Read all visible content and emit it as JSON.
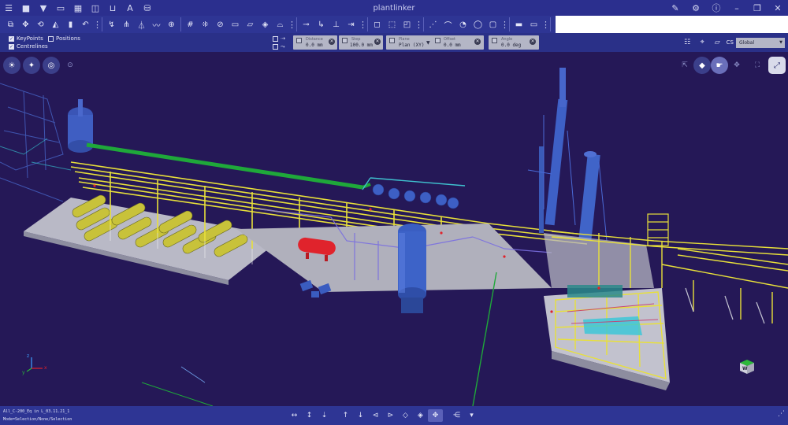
{
  "app": {
    "title": "plantlinker"
  },
  "titlebar": {
    "left_icons": [
      "menu-icon",
      "save-icon",
      "filter-icon",
      "folder-icon",
      "grid-icon",
      "layers-icon",
      "bucket-icon",
      "text-icon",
      "database-icon"
    ],
    "right_icons": [
      "edit-icon",
      "settings-icon",
      "info-icon",
      "minimize-icon",
      "restore-icon",
      "close-icon"
    ]
  },
  "toolbar": {
    "groups": [
      [
        "copy-icon",
        "move-icon",
        "rotate-icon",
        "mirror-icon",
        "delete-icon",
        "undo-icon"
      ],
      [
        "route-icon",
        "branch-icon",
        "tree-icon",
        "line-icon",
        "target-icon"
      ],
      [
        "grid-snap-icon",
        "node-icon",
        "slash-icon",
        "rect-icon",
        "surface-icon",
        "cube-icon",
        "arc-icon"
      ],
      [
        "pipe-icon",
        "bend-icon",
        "tee-icon",
        "connect-icon"
      ],
      [
        "box-icon",
        "box-open-icon",
        "box-layer-icon"
      ],
      [
        "dotline-icon",
        "curve-icon",
        "circle-arrow-icon",
        "circle-icon",
        "shape-icon"
      ],
      [
        "rail-icon",
        "rail-alt-icon"
      ]
    ]
  },
  "options": {
    "checkboxes": [
      {
        "label": "KeyPoints",
        "checked": true
      },
      {
        "label": "Positions",
        "checked": false
      },
      {
        "label": "Centrelines",
        "checked": true
      }
    ],
    "controls": [
      {
        "label": "Distance",
        "value": "0.0 mm"
      },
      {
        "label": "Step",
        "value": "100.0 mm"
      },
      {
        "label": "Plane",
        "value": "Plan (XY)"
      },
      {
        "label": "Offset",
        "value": "0.0 mm"
      },
      {
        "label": "Angle",
        "value": "0.0 deg"
      }
    ],
    "cs_label": "CS",
    "cs_value": "Global"
  },
  "viewport": {
    "left_buttons": [
      "light-icon",
      "bulb-icon",
      "eye-off-icon",
      "dot-icon"
    ],
    "right_buttons": [
      "cursor-icon",
      "crosshair-icon",
      "pointer-icon",
      "hand-icon",
      "fit-icon",
      "expand-icon"
    ],
    "axes": {
      "x": "x",
      "y": "y",
      "z": "z"
    },
    "cube_label": "W"
  },
  "status": {
    "line1": "All_C-200_Eq in L_03.11.21_1",
    "line2": "Mode=Selection/None/Selection",
    "nav_icons": [
      "pan-left-icon",
      "pan-up-icon",
      "pan-down-icon",
      "arrow-up-icon",
      "arrow-down-icon",
      "orbit-left-icon",
      "orbit-right-icon",
      "orbit-up-icon",
      "orbit-down-icon",
      "orbit-all-icon",
      "share-icon",
      "dropdown-icon"
    ]
  },
  "colors": {
    "titlebar": "#2b2f8e",
    "toolbar": "#2e3594",
    "viewport": "#251857",
    "pipe_yellow": "#e8e03a",
    "pipe_green": "#1fa83a",
    "vessel_blue": "#3b63c8",
    "vessel_red": "#e0232c",
    "floor_grey": "#b8b8c4"
  }
}
